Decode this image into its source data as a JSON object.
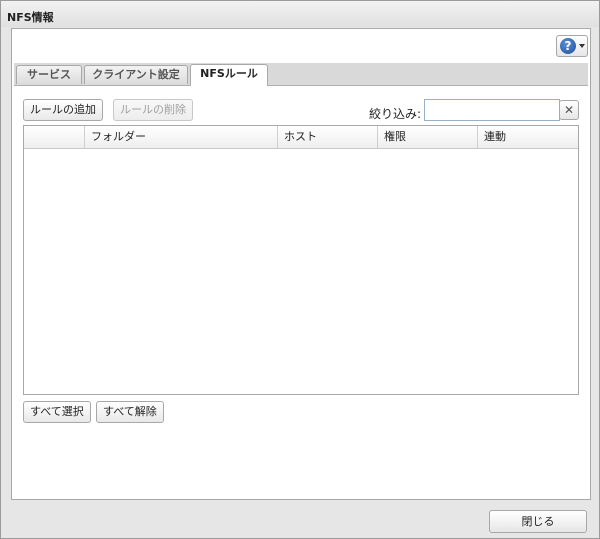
{
  "window": {
    "title": "NFS情報"
  },
  "help": {
    "symbol": "?"
  },
  "tabs": [
    {
      "label": "サービス"
    },
    {
      "label": "クライアント設定"
    },
    {
      "label": "NFSルール"
    }
  ],
  "toolbar": {
    "add_rule": "ルールの追加",
    "delete_rule": "ルールの削除",
    "filter_label": "絞り込み:",
    "filter_value": "",
    "clear_symbol": "✕"
  },
  "table": {
    "columns": [
      "",
      "フォルダー",
      "ホスト",
      "権限",
      "連動"
    ],
    "rows": []
  },
  "selection": {
    "select_all": "すべて選択",
    "deselect_all": "すべて解除"
  },
  "footer": {
    "close": "閉じる"
  },
  "colors": {
    "accent": "#1f4f9c"
  }
}
